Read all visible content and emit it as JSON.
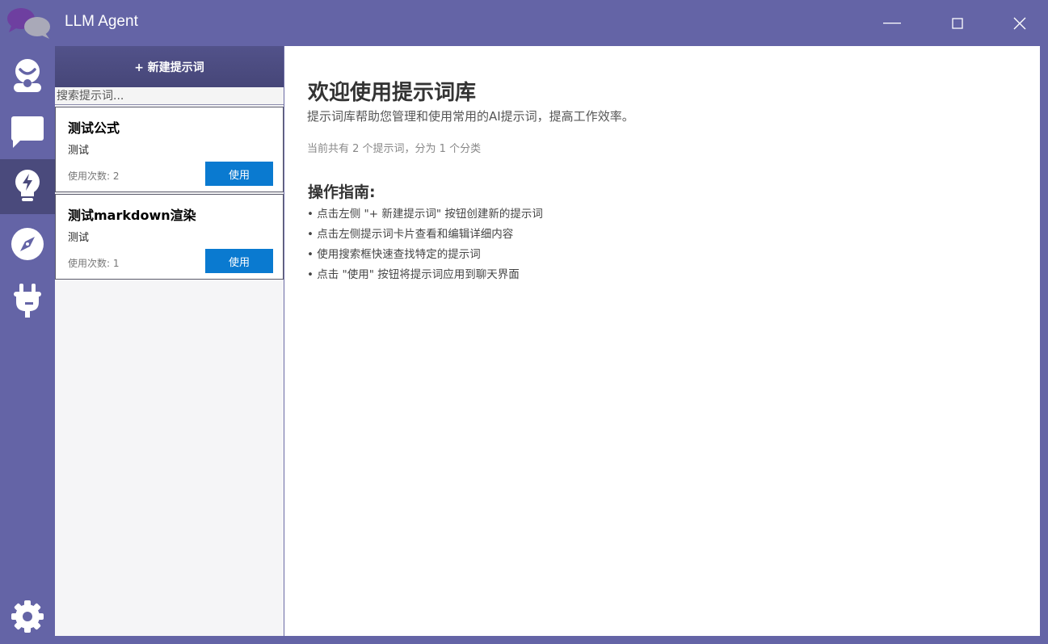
{
  "window": {
    "title": "LLM Agent"
  },
  "sidebar": {
    "new_button": "+ 新建提示词",
    "search_placeholder": "搜索提示词...",
    "cards": [
      {
        "title": "测试公式",
        "description": "测试",
        "usage": "使用次数: 2",
        "use_label": "使用"
      },
      {
        "title": "测试markdown渲染",
        "description": "测试",
        "usage": "使用次数: 1",
        "use_label": "使用"
      }
    ]
  },
  "main": {
    "title": "欢迎使用提示词库",
    "subtitle": "提示词库帮助您管理和使用常用的AI提示词，提高工作效率。",
    "stats": "当前共有 2 个提示词，分为 1 个分类",
    "guide_title": "操作指南:",
    "guide_items": [
      "• 点击左侧 \"+ 新建提示词\" 按钮创建新的提示词",
      "• 点击左侧提示词卡片查看和编辑详细内容",
      "• 使用搜索框快速查找特定的提示词",
      "• 点击 \"使用\" 按钮将提示词应用到聊天界面"
    ]
  },
  "nav": {
    "items": [
      "assistant-icon",
      "chat-icon",
      "prompt-library-icon",
      "explore-icon",
      "plugin-icon"
    ],
    "active": "prompt-library-icon",
    "bottom": "settings-icon"
  },
  "colors": {
    "frame": "#6464a6",
    "active_nav": "#4a4a7c",
    "accent_button": "#0a7ad0",
    "sidebar_bg": "#f5f5f7"
  }
}
